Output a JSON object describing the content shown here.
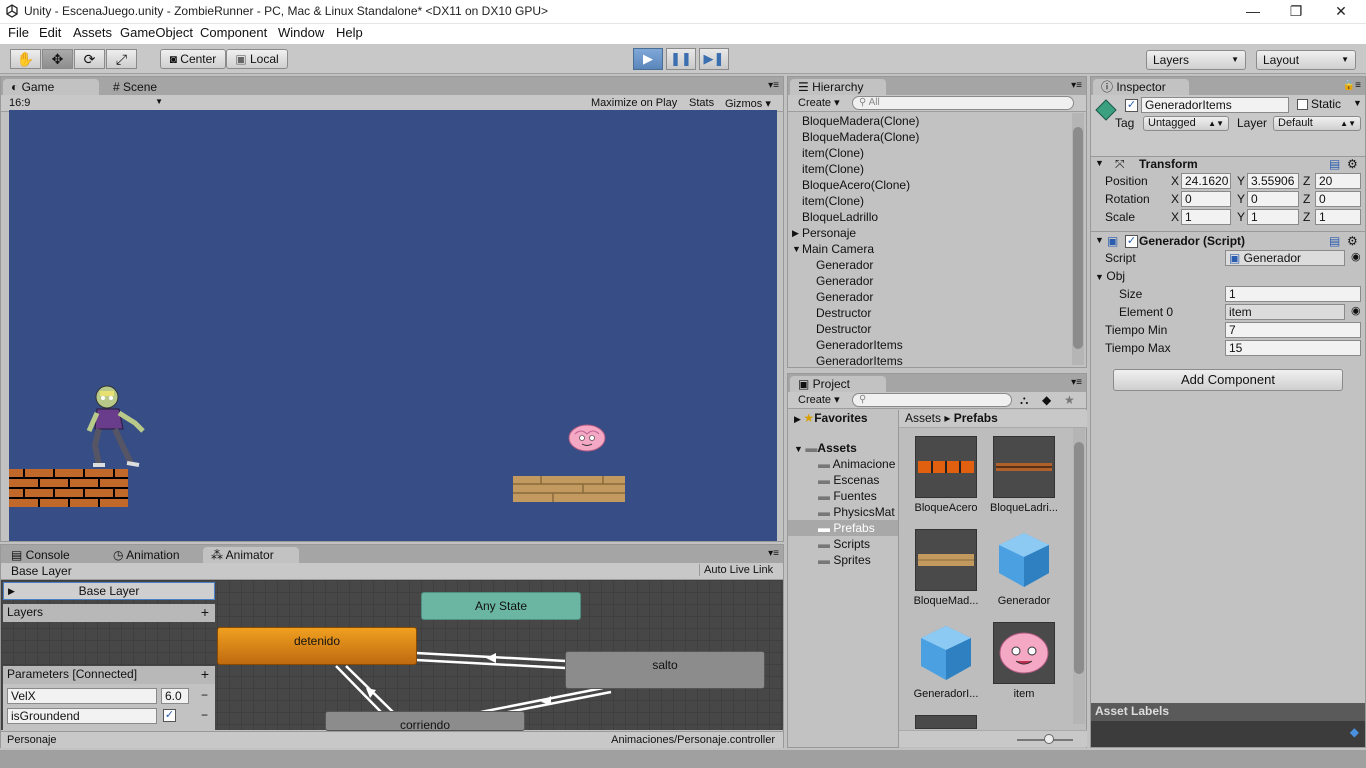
{
  "titlebar": {
    "title": "Unity - EscenaJuego.unity - ZombieRunner - PC, Mac & Linux Standalone* <DX11 on DX10 GPU>",
    "minimize": "—",
    "restore": "❐",
    "close": "✕"
  },
  "menu": [
    "File",
    "Edit",
    "Assets",
    "GameObject",
    "Component",
    "Window",
    "Help"
  ],
  "toolbar": {
    "center": "Center",
    "local": "Local",
    "layers": "Layers",
    "layout": "Layout"
  },
  "game": {
    "tab": "Game",
    "scene_tab": "Scene",
    "aspect": "16:9",
    "maximize": "Maximize on Play",
    "stats": "Stats",
    "gizmos": "Gizmos",
    "bg": "#364d86"
  },
  "hierarchy": {
    "tab": "Hierarchy",
    "create": "Create",
    "search_placeholder": "All",
    "items": [
      "BloqueMadera(Clone)",
      "BloqueMadera(Clone)",
      "item(Clone)",
      "item(Clone)",
      "BloqueAcero(Clone)",
      "item(Clone)",
      "BloqueLadrillo",
      "Personaje",
      "Main Camera"
    ],
    "children": [
      "Generador",
      "Generador",
      "Generador",
      "Destructor",
      "Destructor",
      "GeneradorItems",
      "GeneradorItems"
    ]
  },
  "project": {
    "tab": "Project",
    "create": "Create",
    "favorites": "Favorites",
    "assets": "Assets",
    "folders": [
      "Animacione",
      "Escenas",
      "Fuentes",
      "PhysicsMat",
      "Prefabs",
      "Scripts",
      "Sprites"
    ],
    "breadcrumb_root": "Assets",
    "breadcrumb_sep": "▸",
    "breadcrumb_current": "Prefabs",
    "tiles": [
      "BloqueAcero",
      "BloqueLadri...",
      "BloqueMad...",
      "Generador",
      "GeneradorI...",
      "item"
    ]
  },
  "inspector": {
    "tab": "Inspector",
    "object_name": "GeneradorItems",
    "static": "Static",
    "tag_label": "Tag",
    "tag": "Untagged",
    "layer_label": "Layer",
    "layer": "Default",
    "transform": {
      "title": "Transform",
      "position_label": "Position",
      "rotation_label": "Rotation",
      "scale_label": "Scale",
      "position": [
        "24.1620",
        "3.55906",
        "20"
      ],
      "rotation": [
        "0",
        "0",
        "0"
      ],
      "scale": [
        "1",
        "1",
        "1"
      ]
    },
    "axis": [
      "X",
      "Y",
      "Z"
    ],
    "script_comp": {
      "title": "Generador (Script)",
      "script_label": "Script",
      "script": "Generador",
      "obj_label": "Obj",
      "size_label": "Size",
      "size": "1",
      "element0_label": "Element 0",
      "element0": "item",
      "tmin_label": "Tiempo Min",
      "tmin": "7",
      "tmax_label": "Tiempo Max",
      "tmax": "15"
    },
    "add_component": "Add Component",
    "asset_labels": "Asset Labels"
  },
  "bottom": {
    "tabs": [
      "Console",
      "Animation",
      "Animator"
    ],
    "base_layer": "Base Layer",
    "auto_live_link": "Auto Live Link",
    "layers": "Layers",
    "parameters": "Parameters [Connected]",
    "params": [
      {
        "name": "VelX",
        "value": "6.0"
      },
      {
        "name": "isGroundend",
        "value": "✓"
      }
    ],
    "states": {
      "any": "Any State",
      "detenido": "detenido",
      "salto": "salto",
      "corriendo": "corriendo"
    },
    "status_left": "Personaje",
    "status_right": "Animaciones/Personaje.controller"
  }
}
